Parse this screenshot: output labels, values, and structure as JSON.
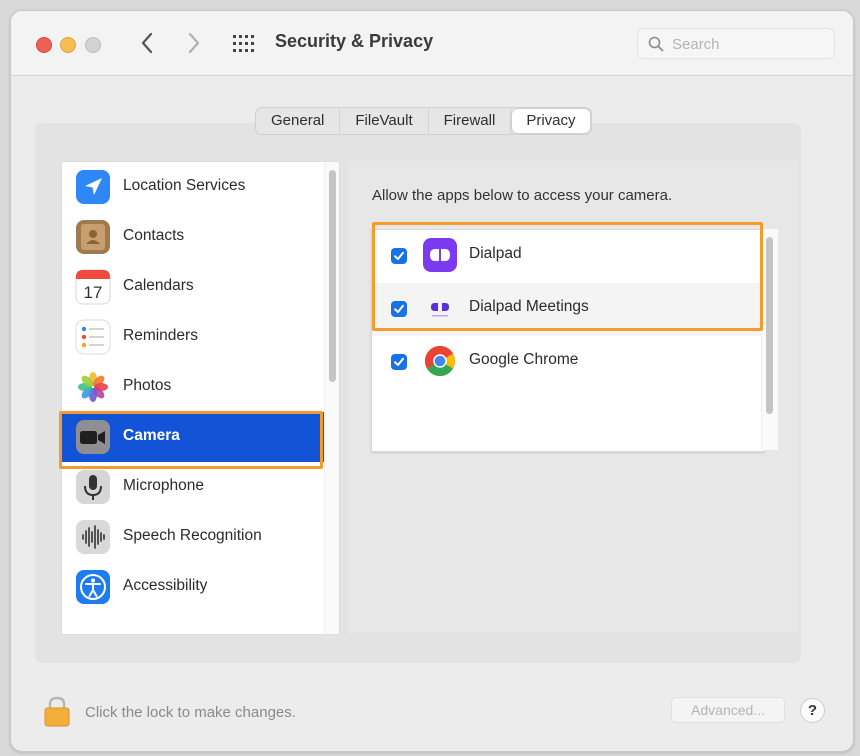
{
  "window": {
    "title": "Security & Privacy",
    "search_placeholder": "Search"
  },
  "tabs": [
    {
      "label": "General",
      "selected": false
    },
    {
      "label": "FileVault",
      "selected": false
    },
    {
      "label": "Firewall",
      "selected": false
    },
    {
      "label": "Privacy",
      "selected": true
    }
  ],
  "sidebar": {
    "items": [
      {
        "label": "Location Services",
        "icon": "location-arrow-icon"
      },
      {
        "label": "Contacts",
        "icon": "contacts-book-icon"
      },
      {
        "label": "Calendars",
        "icon": "calendar-icon",
        "date": "17"
      },
      {
        "label": "Reminders",
        "icon": "reminders-list-icon"
      },
      {
        "label": "Photos",
        "icon": "photos-flower-icon"
      },
      {
        "label": "Camera",
        "icon": "camera-icon",
        "selected": true
      },
      {
        "label": "Microphone",
        "icon": "microphone-icon"
      },
      {
        "label": "Speech Recognition",
        "icon": "speech-waveform-icon"
      },
      {
        "label": "Accessibility",
        "icon": "accessibility-icon"
      }
    ]
  },
  "main": {
    "instruction": "Allow the apps below to access your camera.",
    "apps": [
      {
        "name": "Dialpad",
        "checked": true,
        "icon": "dialpad-icon"
      },
      {
        "name": "Dialpad Meetings",
        "checked": true,
        "icon": "dialpad-meetings-icon"
      },
      {
        "name": "Google Chrome",
        "checked": true,
        "icon": "chrome-icon"
      }
    ]
  },
  "footer": {
    "lock_text": "Click the lock to make changes.",
    "advanced_label": "Advanced...",
    "help_label": "?"
  },
  "colors": {
    "selection_blue": "#1353d8",
    "highlight_orange": "#f39c2b",
    "checkbox_blue": "#1672e6"
  }
}
